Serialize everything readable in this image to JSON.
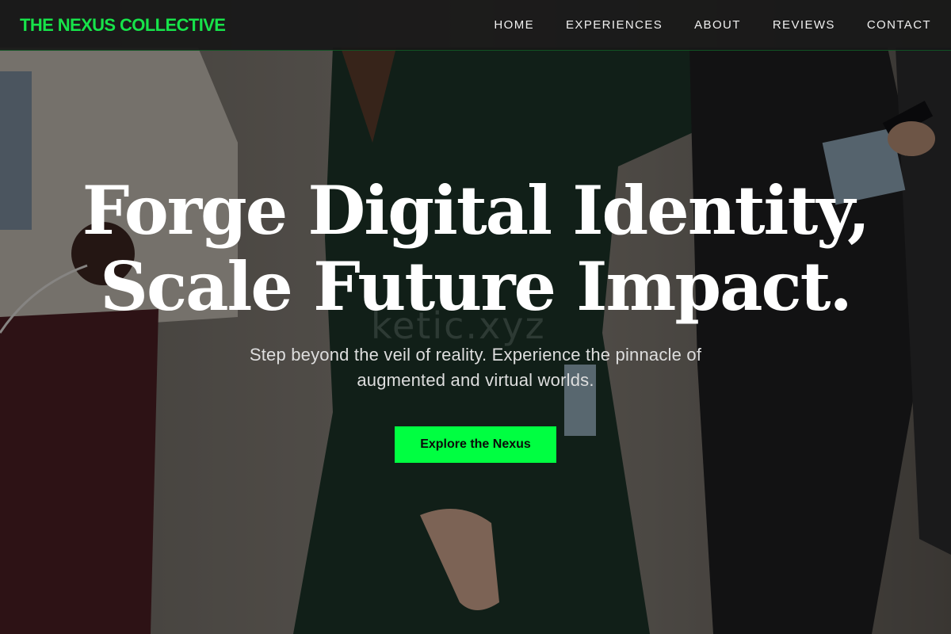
{
  "brand": {
    "name": "THE NEXUS COLLECTIVE",
    "color": "#17e34a"
  },
  "nav": {
    "items": [
      {
        "label": "HOME"
      },
      {
        "label": "EXPERIENCES"
      },
      {
        "label": "ABOUT"
      },
      {
        "label": "REVIEWS"
      },
      {
        "label": "CONTACT"
      }
    ]
  },
  "hero": {
    "title_line1": "Forge Digital Identity,",
    "title_line2": "Scale Future Impact.",
    "subtitle": "Step beyond the veil of reality. Experience the pinnacle of augmented and virtual worlds.",
    "cta_label": "Explore the Nexus",
    "cta_color": "#00ff41",
    "watermark_text": "ketic.xyz"
  },
  "background": {
    "icon": "photo-people-walking",
    "overlay_color": "#000000"
  }
}
